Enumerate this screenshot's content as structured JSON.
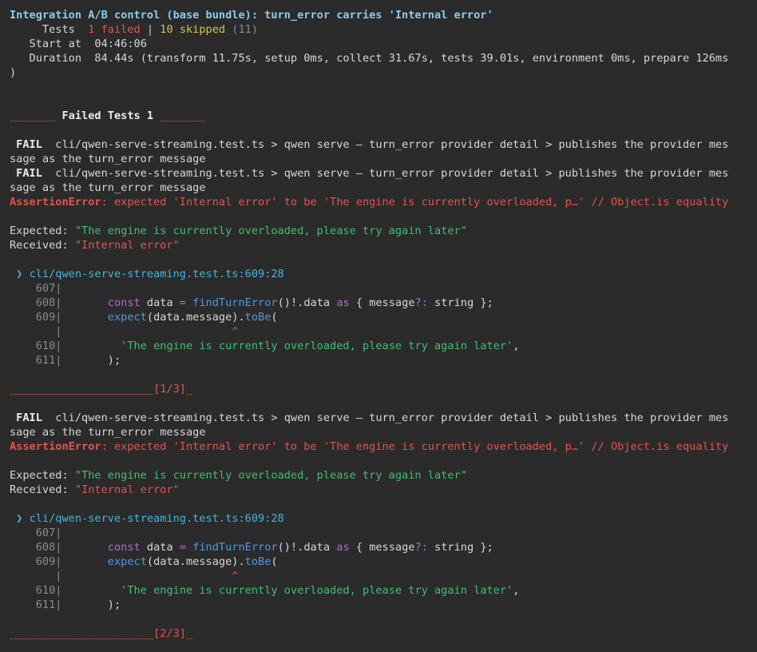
{
  "header": {
    "title": "Integration A/B control (base bundle): turn_error carries 'Internal error'",
    "tests_label": "     Tests  ",
    "failed": "1 failed",
    "sep": " | ",
    "skipped": "10 skipped",
    "total": " (11)",
    "start_label": "   Start at  ",
    "start_value": "04:46:06",
    "duration_label": "   Duration  ",
    "duration_value": "84.44s (transform 11.75s, setup 0ms, collect 31.67s, tests 39.01s, environment 0ms, prepare 126ms",
    "duration_close": ")"
  },
  "failed_header": {
    "left_rule": "_______",
    "label": " Failed Tests 1 ",
    "right_rule": "_______"
  },
  "fail_lines": {
    "badge": " FAIL ",
    "path": " cli/qwen-serve-streaming.test.ts > qwen serve — turn_error provider detail > publishes the provider mes",
    "path_cont": "sage as the turn_error message"
  },
  "blocks": [
    {
      "assertion_label": "AssertionError",
      "assertion_text": ": expected 'Internal error' to be 'The engine is currently overloaded, p…' // Object.is equality",
      "expected_label": "Expected: ",
      "expected_value": "\"The engine is currently overloaded, please try again later\"",
      "received_label": "Received: ",
      "received_value": "\"Internal error\"",
      "location_marker": " ❯ ",
      "location": "cli/qwen-serve-streaming.test.ts:609:28",
      "code": {
        "l607": "    607|",
        "l608": "    608|",
        "l608_indent": "       ",
        "l608_const": "const",
        "l608_data": " data ",
        "l608_eq": "=",
        "l608_sp": " ",
        "l608_fn": "findTurnError",
        "l608_call": "()!.data ",
        "l608_as": "as",
        "l608_type_open": " { message",
        "l608_q": "?:",
        "l608_type_close": " string };",
        "l609": "    609|",
        "l609_indent": "       ",
        "l609_expect": "expect",
        "l609_args": "(data.message).",
        "l609_tobe": "toBe",
        "l609_paren": "(",
        "caret_pipe": "       |",
        "caret_pad": "                          ",
        "caret": "^",
        "l610": "    610|",
        "l610_indent": "         ",
        "l610_str": "'The engine is currently overloaded, please try again later'",
        "l610_comma": ",",
        "l611": "    611|",
        "l611_indent": "       ",
        "l611_close": ");"
      },
      "footer_rule": "______________________",
      "footer_counter": "[1/3]",
      "footer_tail": "_"
    },
    {
      "assertion_label": "AssertionError",
      "assertion_text": ": expected 'Internal error' to be 'The engine is currently overloaded, p…' // Object.is equality",
      "expected_label": "Expected: ",
      "expected_value": "\"The engine is currently overloaded, please try again later\"",
      "received_label": "Received: ",
      "received_value": "\"Internal error\"",
      "location_marker": " ❯ ",
      "location": "cli/qwen-serve-streaming.test.ts:609:28",
      "code": {
        "l607": "    607|",
        "l608": "    608|",
        "l608_indent": "       ",
        "l608_const": "const",
        "l608_data": " data ",
        "l608_eq": "=",
        "l608_sp": " ",
        "l608_fn": "findTurnError",
        "l608_call": "()!.data ",
        "l608_as": "as",
        "l608_type_open": " { message",
        "l608_q": "?:",
        "l608_type_close": " string };",
        "l609": "    609|",
        "l609_indent": "       ",
        "l609_expect": "expect",
        "l609_args": "(data.message).",
        "l609_tobe": "toBe",
        "l609_paren": "(",
        "caret_pipe": "       |",
        "caret_pad": "                          ",
        "caret": "^",
        "l610": "    610|",
        "l610_indent": "         ",
        "l610_str": "'The engine is currently overloaded, please try again later'",
        "l610_comma": ",",
        "l611": "    611|",
        "l611_indent": "       ",
        "l611_close": ");"
      },
      "footer_rule": "______________________",
      "footer_counter": "[2/3]",
      "footer_tail": "_"
    }
  ]
}
